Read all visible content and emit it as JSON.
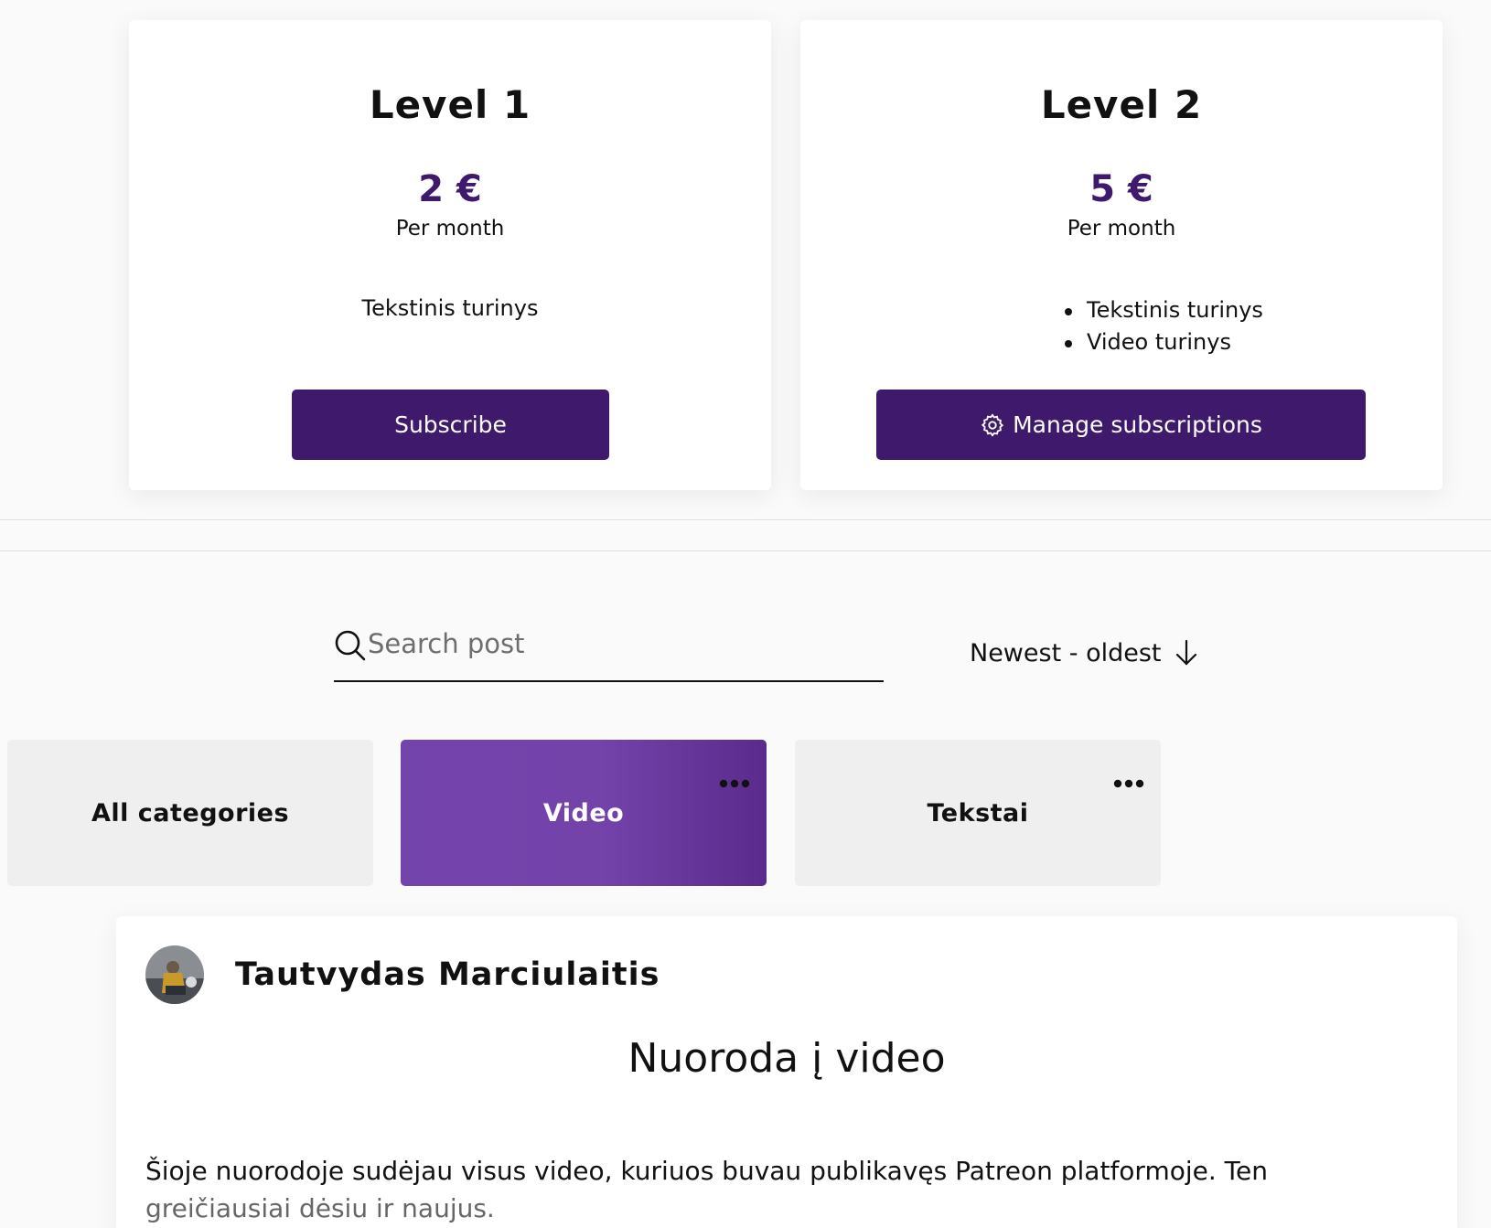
{
  "tiers": [
    {
      "title": "Level 1",
      "price": "2 €",
      "period": "Per month",
      "benefits": [
        "Tekstinis turinys"
      ],
      "button_label": "Subscribe"
    },
    {
      "title": "Level 2",
      "price": "5 €",
      "period": "Per month",
      "benefits": [
        "Tekstinis turinys",
        "Video turinys"
      ],
      "button_label": "Manage subscriptions",
      "button_icon": "gear-icon"
    }
  ],
  "search": {
    "placeholder": "Search post",
    "value": "",
    "icon": "search-icon"
  },
  "sort": {
    "selected": "Newest - oldest",
    "icon": "arrow-down-icon"
  },
  "categories": [
    {
      "label": "All categories",
      "active": false
    },
    {
      "label": "Video",
      "active": true,
      "has_menu": true
    },
    {
      "label": "Tekstai",
      "active": false,
      "has_menu": true
    }
  ],
  "post": {
    "author": "Tautvydas Marciulaitis",
    "title": "Nuoroda į video",
    "body_line1": "Šioje nuorodoje sudėjau visus video, kuriuos buvau publikavęs Patreon platformoje. Ten",
    "body_line2": "greičiausiai dėsiu ir naujus."
  },
  "colors": {
    "brand": "#3f1a6c",
    "active_category": "#7444ad",
    "tile_bg": "#efefef"
  }
}
